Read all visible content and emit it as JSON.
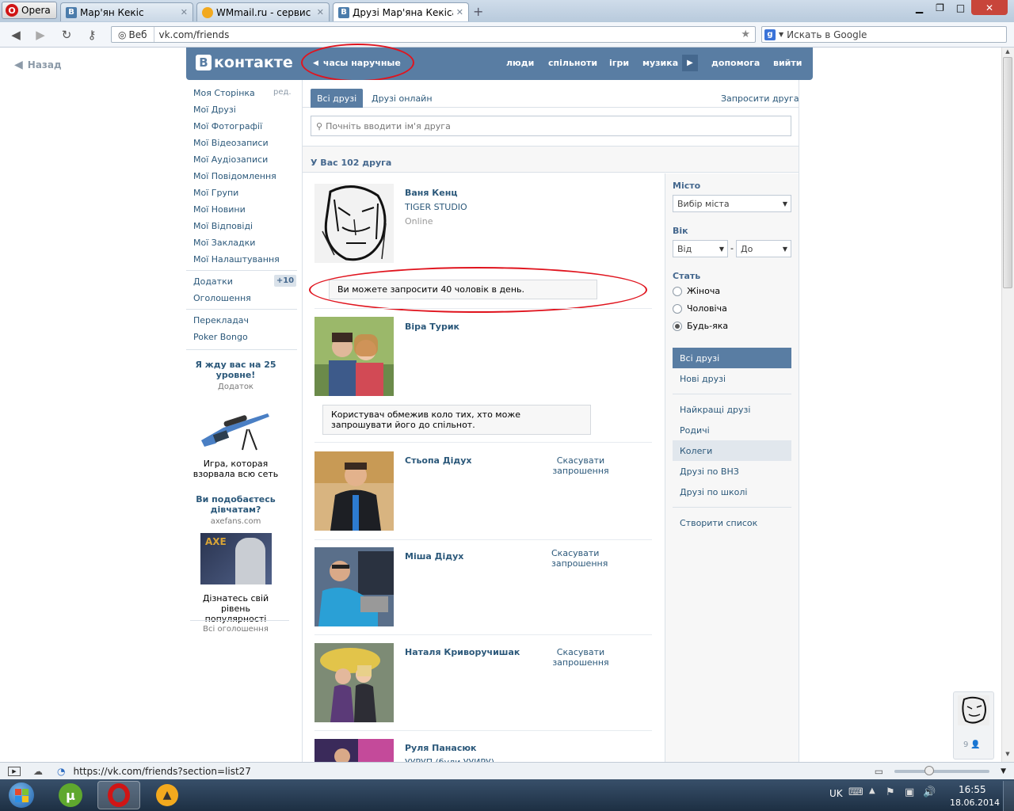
{
  "browser": {
    "menu_label": "Opera",
    "tabs": [
      {
        "label": "Мар'ян Кекіс",
        "active": false
      },
      {
        "label": "WMmail.ru - сервис п...",
        "active": false
      },
      {
        "label": "Друзі Мар'яна Кекіса |...",
        "active": true
      }
    ],
    "web_label": "Веб",
    "url": "vk.com/friends",
    "search_placeholder": "Искать в Google",
    "status_url": "https://vk.com/friends?section=list27"
  },
  "page": {
    "back_label": "Назад",
    "logo_text": "контакте",
    "header_back": "часы наручные",
    "nav": [
      "люди",
      "спільноти",
      "ігри",
      "музика",
      "допомога",
      "вийти"
    ]
  },
  "left_menu": {
    "my_page": "Моя Сторінка",
    "edit": "ред.",
    "items": [
      "Мої Друзі",
      "Мої Фотографії",
      "Мої Відеозаписи",
      "Мої Аудіозаписи",
      "Мої Повідомлення",
      "Мої Групи",
      "Мої Новини",
      "Мої Відповіді",
      "Мої Закладки",
      "Мої Налаштування"
    ],
    "apps": "Додатки",
    "apps_badge": "+10",
    "ads": "Оголошення",
    "extra": [
      "Перекладач",
      "Poker Bongo"
    ]
  },
  "ads": {
    "ad1_title": "Я жду вас на 25 уровне!",
    "ad1_sub": "Додаток",
    "ad1_text": "Игра, которая взорвала всю сеть",
    "ad2_title": "Ви подобаєтесь дівчатам?",
    "ad2_sub": "axefans.com",
    "ad2_brand": "AXE",
    "ad2_text": "Дізнатесь свій рівень популярності",
    "all_ads": "Всі оголошення"
  },
  "content": {
    "tab_all": "Всі друзі",
    "tab_online": "Друзі онлайн",
    "invite": "Запросити друга",
    "search_placeholder": "Почніть вводити ім'я друга",
    "count": "У Вас 102 друга",
    "friends": [
      {
        "name": "Ваня Кенц",
        "line1": "TIGER STUDIO",
        "line2": "Online"
      },
      {
        "name": "Віра Турик"
      },
      {
        "name": "Стьопа Дідух",
        "action": "Скасувати запрошення"
      },
      {
        "name": "Міша Дідух",
        "action": "Скасувати запрошення"
      },
      {
        "name": "Наталя Криворучишак",
        "action": "Скасувати запрошення"
      },
      {
        "name": "Руля Панасюк",
        "line1": "УУРУП (були УУИРУ)"
      }
    ],
    "notice_invite": "Ви можете запросити 40 чоловік в день.",
    "notice_restricted": "Користувач обмежив коло тих, хто може запрошувати його до спільнот."
  },
  "filter": {
    "city_label": "Місто",
    "city_select": "Вибір міста",
    "age_label": "Вік",
    "age_from": "Від",
    "age_to": "До",
    "sex_label": "Стать",
    "sex_options": [
      "Жіноча",
      "Чоловіча",
      "Будь-яка"
    ],
    "lists": [
      "Всі друзі",
      "Нові друзі",
      "Найкращі друзі",
      "Родичі",
      "Колеги",
      "Друзі по ВНЗ",
      "Друзі по школі",
      "Створити список"
    ]
  },
  "sidebar_mini": {
    "count": "9"
  },
  "taskbar": {
    "lang": "UK",
    "time": "16:55",
    "date": "18.06.2014"
  }
}
